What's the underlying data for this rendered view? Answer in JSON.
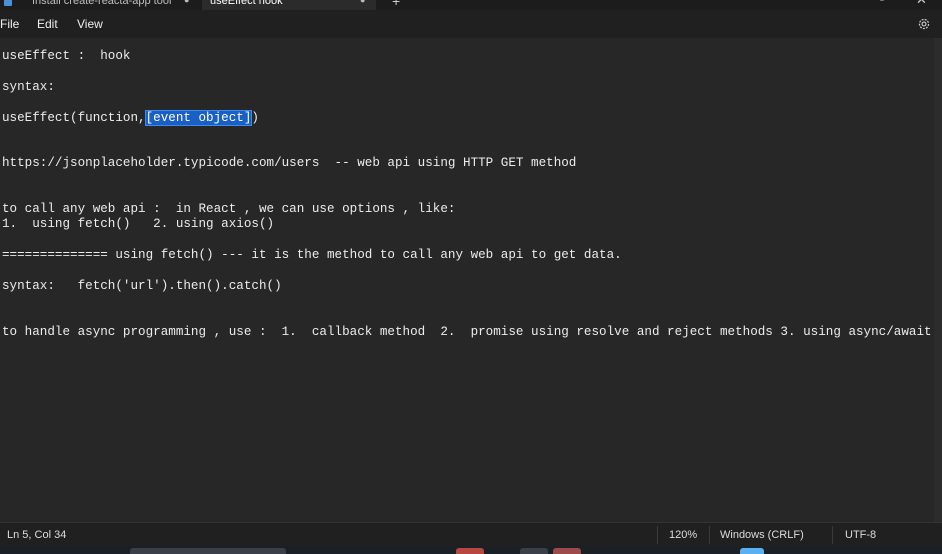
{
  "tabs": [
    {
      "label": "Install create-reacta-app tool"
    },
    {
      "label": "useEffect  hook"
    }
  ],
  "menu": {
    "file": "File",
    "edit": "Edit",
    "view": "View"
  },
  "editor": {
    "lines": [
      "useEffect :  hook",
      "syntax:",
      "useEffect(function,",
      "[event object]",
      ")",
      "https://jsonplaceholder.typicode.com/users  -- web api using HTTP GET method",
      "to call any web api :  in React , we can use options , like:",
      "1.  using fetch()   2. using axios()",
      "============== using fetch() --- it is the method to call any web api to get data.",
      "syntax:   fetch('url').then().catch()",
      "to handle async programming , use :  1.  callback method  2.  promise using resolve and reject methods 3. using async/await"
    ]
  },
  "status": {
    "position": "Ln 5, Col 34",
    "zoom": "120%",
    "line_ending": "Windows (CRLF)",
    "encoding": "UTF-8"
  },
  "colors": {
    "background": "#272727",
    "selection": "#1a5fc4"
  }
}
